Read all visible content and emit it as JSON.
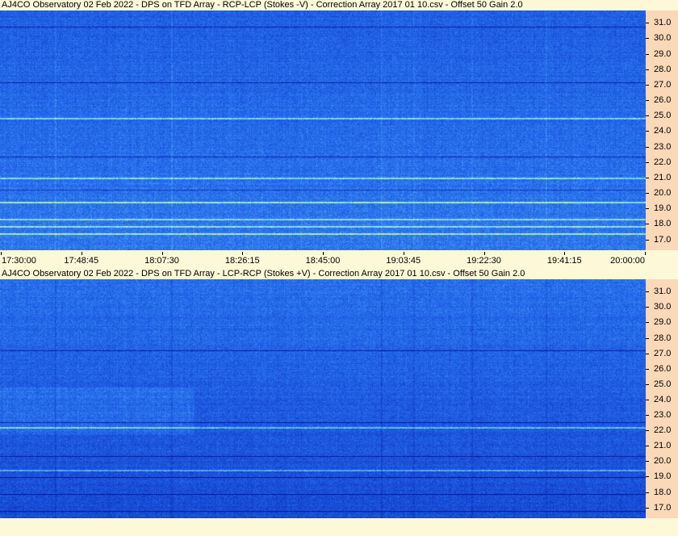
{
  "panels": [
    {
      "title": "AJ4CO Observatory 02 Feb 2022  -  DPS on TFD Array  -  RCP-LCP (Stokes -V)  -  Correction Array 2017 01 10.csv  -  Offset 50  Gain 2.0",
      "seed": 7
    },
    {
      "title": "AJ4CO Observatory 02 Feb 2022  -  DPS on TFD Array  -  LCP-RCP (Stokes +V)  -  Correction Array 2017 01 10.csv  -  Offset 50  Gain 2.0",
      "seed": 13
    }
  ],
  "chart_data": {
    "type": "heatmap",
    "x_tick_labels": [
      "17:30:00",
      "17:48:45",
      "18:07:30",
      "18:26:15",
      "18:45:00",
      "19:03:45",
      "19:22:30",
      "19:41:15",
      "20:00:00"
    ],
    "y_tick_labels": [
      "31.0",
      "30.0",
      "29.0",
      "28.0",
      "27.0",
      "26.0",
      "25.0",
      "24.0",
      "23.0",
      "22.0",
      "21.0",
      "20.0",
      "19.0",
      "18.0",
      "17.0"
    ],
    "y_tick_values": [
      31,
      30,
      29,
      28,
      27,
      26,
      25,
      24,
      23,
      22,
      21,
      20,
      19,
      18,
      17
    ],
    "ylim": [
      16.3,
      31.8
    ],
    "x_range": [
      "17:30:00",
      "20:00:00"
    ],
    "colors": {
      "low": "#0a1aa8",
      "mid": "#2a6fe6",
      "high": "#6fd8f0",
      "peak": "#f0f060",
      "axis_panel": "#fad8b8",
      "background": "#fdf8d8"
    }
  }
}
